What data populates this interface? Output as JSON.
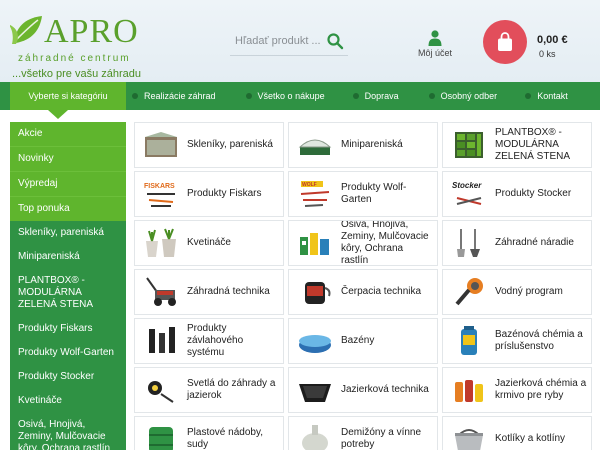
{
  "logo": {
    "name": "APRO",
    "subtitle": "záhradné centrum",
    "slogan": "...všetko pre vašu záhradu"
  },
  "search": {
    "placeholder": "Hľadať produkt ..."
  },
  "account": {
    "label": "Môj účet"
  },
  "cart": {
    "price": "0,00 €",
    "count": "0 ks"
  },
  "nav": {
    "category_button": "Vyberte si kategóriu",
    "items": [
      {
        "label": "Realizácie záhrad"
      },
      {
        "label": "Všetko o nákupe"
      },
      {
        "label": "Doprava"
      },
      {
        "label": "Osobný odber"
      },
      {
        "label": "Kontakt"
      }
    ]
  },
  "sidebar": {
    "items": [
      {
        "label": "Akcie"
      },
      {
        "label": "Novinky"
      },
      {
        "label": "Výpredaj"
      },
      {
        "label": "Top ponuka"
      },
      {
        "label": "Skleníky, pareniská"
      },
      {
        "label": "Minipareniská"
      },
      {
        "label": "PLANTBOX® - MODULÁRNA ZELENÁ STENA"
      },
      {
        "label": "Produkty Fiskars"
      },
      {
        "label": "Produkty Wolf-Garten"
      },
      {
        "label": "Produkty Stocker"
      },
      {
        "label": "Kvetináče"
      },
      {
        "label": "Osivá, Hnojivá, Zeminy, Mulčovacie kôry, Ochrana rastlín"
      }
    ]
  },
  "categories": [
    {
      "label": "Skleníky, pareniská",
      "icon": "greenhouse-icon"
    },
    {
      "label": "Minipareniská",
      "icon": "mini-greenhouse-icon"
    },
    {
      "label": "PLANTBOX® - MODULÁRNA ZELENÁ STENA",
      "icon": "plantbox-icon"
    },
    {
      "label": "Produkty Fiskars",
      "icon": "fiskars-icon"
    },
    {
      "label": "Produkty Wolf-Garten",
      "icon": "wolf-garten-icon"
    },
    {
      "label": "Produkty Stocker",
      "icon": "stocker-icon"
    },
    {
      "label": "Kvetináče",
      "icon": "flowerpot-icon"
    },
    {
      "label": "Osivá, Hnojivá, Zeminy, Mulčovacie kôry, Ochrana rastlín",
      "icon": "fertilizer-icon"
    },
    {
      "label": "Záhradné náradie",
      "icon": "garden-tools-icon"
    },
    {
      "label": "Záhradná technika",
      "icon": "lawn-mower-icon"
    },
    {
      "label": "Čerpacia technika",
      "icon": "pump-icon"
    },
    {
      "label": "Vodný program",
      "icon": "spray-nozzle-icon"
    },
    {
      "label": "Produkty závlahového systému",
      "icon": "sprinkler-icon"
    },
    {
      "label": "Bazény",
      "icon": "pool-icon"
    },
    {
      "label": "Bazénová chémia a príslušenstvo",
      "icon": "pool-chemistry-icon"
    },
    {
      "label": "Svetlá do záhrady a jazierok",
      "icon": "garden-light-icon"
    },
    {
      "label": "Jazierková technika",
      "icon": "pond-liner-icon"
    },
    {
      "label": "Jazierková chémia a krmivo pre ryby",
      "icon": "pond-chemistry-icon"
    },
    {
      "label": "Plastové nádoby, sudy",
      "icon": "barrel-icon"
    },
    {
      "label": "Demižóny a vínne potreby",
      "icon": "demijohn-icon"
    },
    {
      "label": "Kotlíky a kotlíny",
      "icon": "cauldron-icon"
    }
  ]
}
